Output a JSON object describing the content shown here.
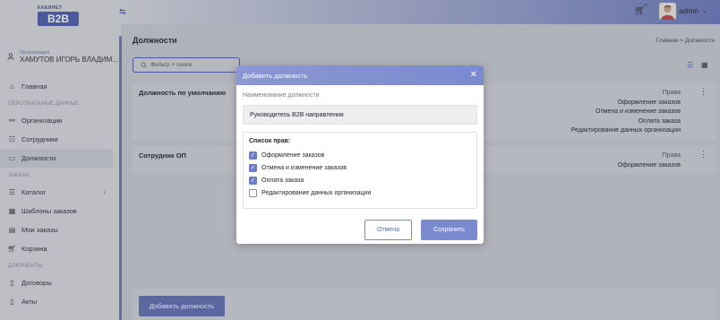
{
  "logo": {
    "top": "КАБИНЕТ",
    "mark": "B2B"
  },
  "org": {
    "caption": "Организация",
    "name": "ХАМУТОВ ИГОРЬ ВЛАДИМ..."
  },
  "nav": {
    "home": "Главная",
    "section_personal": "ПЕРСОНАЛЬНЫЕ ДАННЫЕ",
    "orgs": "Организации",
    "staff": "Сотрудники",
    "positions": "Должности",
    "section_orders": "ЗАКАЗЫ",
    "catalog": "Каталог",
    "templates": "Шаблоны заказов",
    "my_orders": "Мои заказы",
    "cart": "Корзина",
    "section_docs": "ДОКУМЕНТЫ",
    "contracts": "Договоры",
    "acts": "Акты"
  },
  "header": {
    "cart_count": "0",
    "user": "admin"
  },
  "page": {
    "title": "Должности",
    "crumb_home": "Главная",
    "crumb_sep": ">",
    "crumb_current": "Должности",
    "filter_placeholder": "Фильтр + поиск",
    "add_button": "Добавить должность"
  },
  "cards": [
    {
      "title": "Должность по умолчанию",
      "rights_label": "Права",
      "rights": [
        "Оформление заказов",
        "Отмена и изменение заказов",
        "Оплата заказа",
        "Редактирование данных организации"
      ]
    },
    {
      "title": "Сотрудник ОП",
      "rights_label": "Права",
      "rights": [
        "Оформление заказов"
      ]
    }
  ],
  "modal": {
    "title": "Добавить должность",
    "name_label": "Наименование должности",
    "name_value": "Руководитель B2B направления",
    "rights_title": "Список прав:",
    "rights": [
      {
        "label": "Оформление заказов",
        "checked": true
      },
      {
        "label": "Отмена и изменение заказов",
        "checked": true
      },
      {
        "label": "Оплата заказа",
        "checked": true
      },
      {
        "label": "Редактирование данных организации",
        "checked": false
      }
    ],
    "cancel": "Отмена",
    "save": "Сохранить"
  },
  "colors": {
    "accent": "#4b5dab",
    "modal_header": "#8b98d4",
    "checkbox": "#6b7cc9"
  }
}
